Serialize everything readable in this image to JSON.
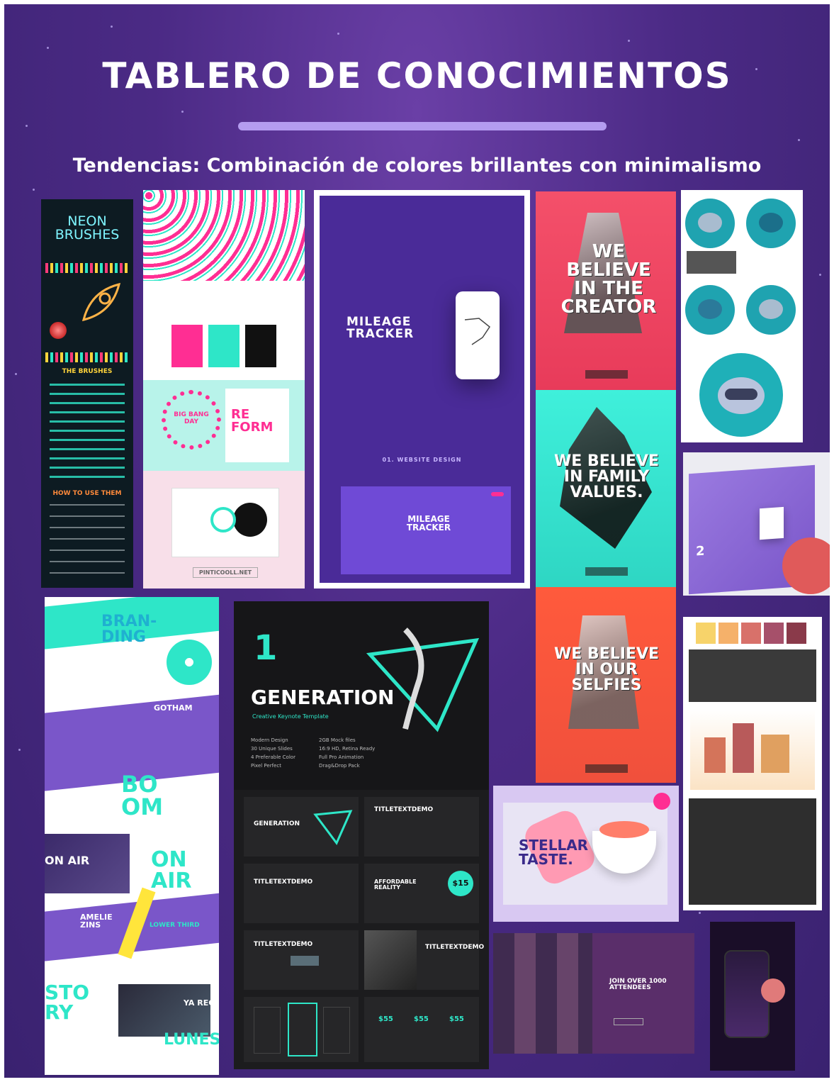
{
  "header": {
    "title": "TABLERO DE CONOCIMIENTOS",
    "subtitle": "Tendencias: Combinación de colores brillantes con minimalismo"
  },
  "colors": {
    "background": "#4b2a85",
    "accent_purple": "#b49cf0",
    "teal": "#2ee6c8",
    "pink": "#ff2e93",
    "coral": "#f0503c"
  },
  "tiles": {
    "neon": {
      "title": "NEON BRUSHES",
      "section": "THE BRUSHES",
      "howto": "HOW TO USE THEM"
    },
    "pattern": {
      "reform": "RE FORM",
      "big_bang": "BIG BANG DAY",
      "footer": "PINTICOOLL.NET"
    },
    "mileage": {
      "title": "MILEAGE TRACKER",
      "caption": "01. WEBSITE DESIGN",
      "title2": "MILEAGE TRACKER"
    },
    "poster1": {
      "text": "WE BELIEVE IN THE CREATOR"
    },
    "poster2": {
      "text": "WE BELIEVE IN FAMILY VALUES."
    },
    "poster3": {
      "text": "WE BELIEVE IN OUR SELFIES"
    },
    "app_slide": {
      "number": "2"
    },
    "branding": {
      "branding": "BRAN- DING",
      "gotham": "GOTHAM",
      "boom": "BO OM",
      "on_air": "ON AIR",
      "on_air2": "ON AIR",
      "amelie": "AMELIE ZINS",
      "lower_third": "LOWER THIRD",
      "story": "STO RY",
      "lunes": "LUNES",
      "ya_reg": "YA REG"
    },
    "generation": {
      "logo": "1",
      "title": "GENERATION",
      "tagline": "Creative Keynote Template",
      "features": [
        "Modern Design",
        "30 Unique Slides",
        "4 Preferable Color",
        "Pixel Perfect",
        "2GB Mock files",
        "16:9 HD, Retina Ready",
        "Full Pro Animation",
        "Drag&Drop Pack"
      ],
      "thumb_generation": "GENERATION",
      "thumb_title1": "TITLETEXTDEMO",
      "thumb_title2": "TITLETEXTDEMO",
      "thumb_afford": "AFFORDABLE REALITY",
      "thumb_price": "$15",
      "thumb_title3": "TITLETEXTDEMO",
      "thumb_title4": "TITLETEXTDEMO",
      "prices": [
        "$55",
        "$55",
        "$55"
      ]
    },
    "stellar": {
      "title": "STELLAR TASTE."
    },
    "attendees": {
      "title": "JOIN OVER 1000 ATTENDEES"
    }
  }
}
